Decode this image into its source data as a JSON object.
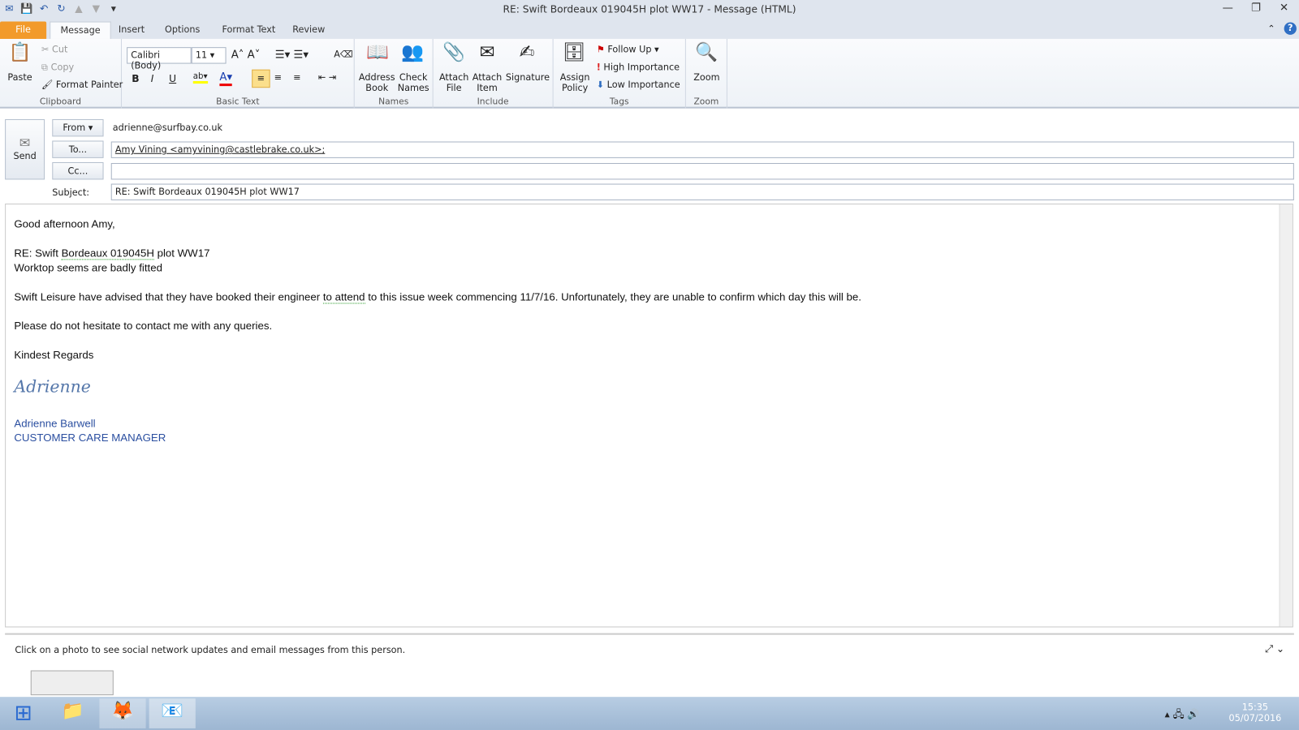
{
  "window": {
    "title": "RE: Swift Bordeaux  019045H plot WW17  -  Message (HTML)"
  },
  "tabs": [
    "File",
    "Message",
    "Insert",
    "Options",
    "Format Text",
    "Review"
  ],
  "ribbon": {
    "clipboard": {
      "label": "Clipboard",
      "paste": "Paste",
      "cut": "Cut",
      "copy": "Copy",
      "format_painter": "Format Painter"
    },
    "basic_text": {
      "label": "Basic Text",
      "font": "Calibri (Body)",
      "size": "11"
    },
    "names": {
      "label": "Names",
      "address_book": "Address Book",
      "check_names": "Check Names"
    },
    "include": {
      "label": "Include",
      "attach_file": "Attach File",
      "attach_item": "Attach Item",
      "signature": "Signature"
    },
    "tags": {
      "label": "Tags",
      "assign_policy": "Assign Policy",
      "follow_up": "Follow Up",
      "high": "High Importance",
      "low": "Low Importance"
    },
    "zoom": {
      "label": "Zoom",
      "zoom": "Zoom"
    }
  },
  "compose": {
    "send": "Send",
    "from_btn": "From",
    "from": "adrienne@surfbay.co.uk",
    "to_btn": "To...",
    "to": "Amy Vining <amyvining@castlebrake.co.uk>;",
    "cc_btn": "Cc...",
    "cc": "",
    "subject_label": "Subject:",
    "subject": "RE: Swift Bordeaux  019045H plot WW17"
  },
  "body": {
    "greeting": "Good afternoon Amy,",
    "re_a": "RE: Swift ",
    "re_b": "Bordeaux  019045H",
    "re_c": " plot WW17",
    "line2": "Worktop seems are badly fitted",
    "p1a": "Swift Leisure have advised that they have booked their engineer ",
    "p1b": "to  attend",
    "p1c": " to this issue week commencing 11/7/16.  Unfortunately, they are unable to confirm which day this will be.",
    "p2": "Please do not hesitate to contact me with any queries.",
    "closing": "Kindest Regards",
    "sig_script": "Adrienne",
    "sig_name": "Adrienne Barwell",
    "sig_title": "CUSTOMER CARE MANAGER"
  },
  "people_pane": {
    "text": "Click on a photo to see social network updates and email messages from this person."
  },
  "taskbar": {
    "time": "15:35",
    "date": "05/07/2016"
  }
}
